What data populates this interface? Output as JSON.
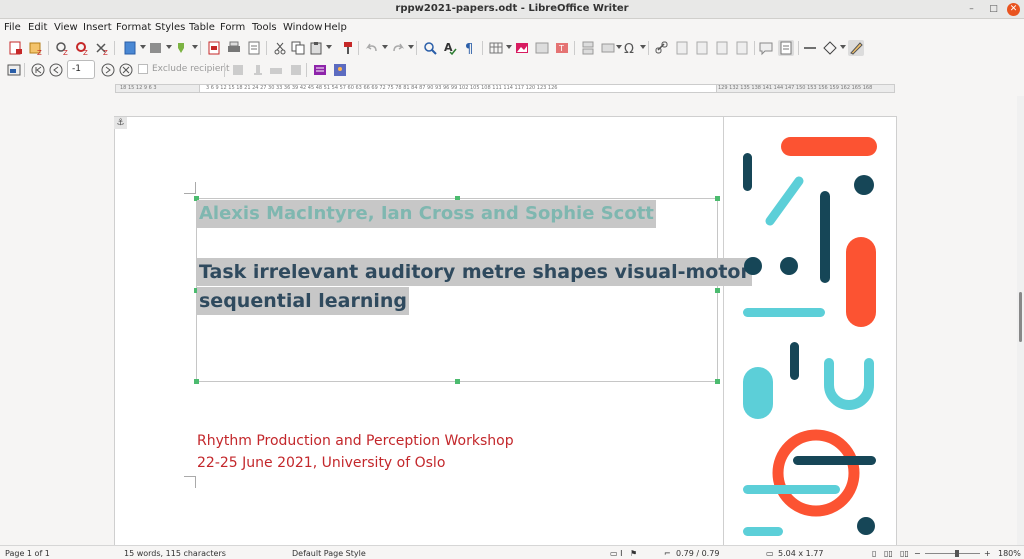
{
  "window": {
    "title": "rppw2021-papers.odt - LibreOffice Writer"
  },
  "menu": [
    "File",
    "Edit",
    "View",
    "Insert",
    "Format",
    "Styles",
    "Table",
    "Form",
    "Tools",
    "Window",
    "Help"
  ],
  "mailmerge": {
    "record_value": "-1",
    "exclude_label": "Exclude recipient"
  },
  "ruler": {
    "left_ticks": "18 15 12 9 6 3",
    "main_ticks": "3 6 9 12 15 18 21 24 27 30 33 36 39 42 45 48 51 54 57 60 63 66 69 72 75 78 81 84 87 90 93 96 99 102 105 108 111 114 117 120 123 126",
    "right_ticks": "129 132 135 138 141 144 147 150 153 156 159 162 165 168"
  },
  "document": {
    "authors": "Alexis MacIntyre, Ian Cross and Sophie Scott",
    "title_line1": "Task irrelevant auditory metre shapes visual-motor",
    "title_line2": "sequential learning",
    "workshop_line1": "Rhythm Production and Perception Workshop",
    "workshop_line2": "22-25 June 2021, University of Oslo"
  },
  "colors": {
    "author_text": "#7fb7b0",
    "title_text": "#2f4a5e",
    "workshop_text": "#c3272b",
    "deco_orange": "#fc5332",
    "deco_teal": "#5ccfd8",
    "deco_navy": "#164657"
  },
  "status": {
    "page": "Page 1 of 1",
    "words": "15 words, 115 characters",
    "style": "Default Page Style",
    "position": "0.79 / 0.79",
    "size": "5.04 x 1.77",
    "zoom": "180%"
  }
}
